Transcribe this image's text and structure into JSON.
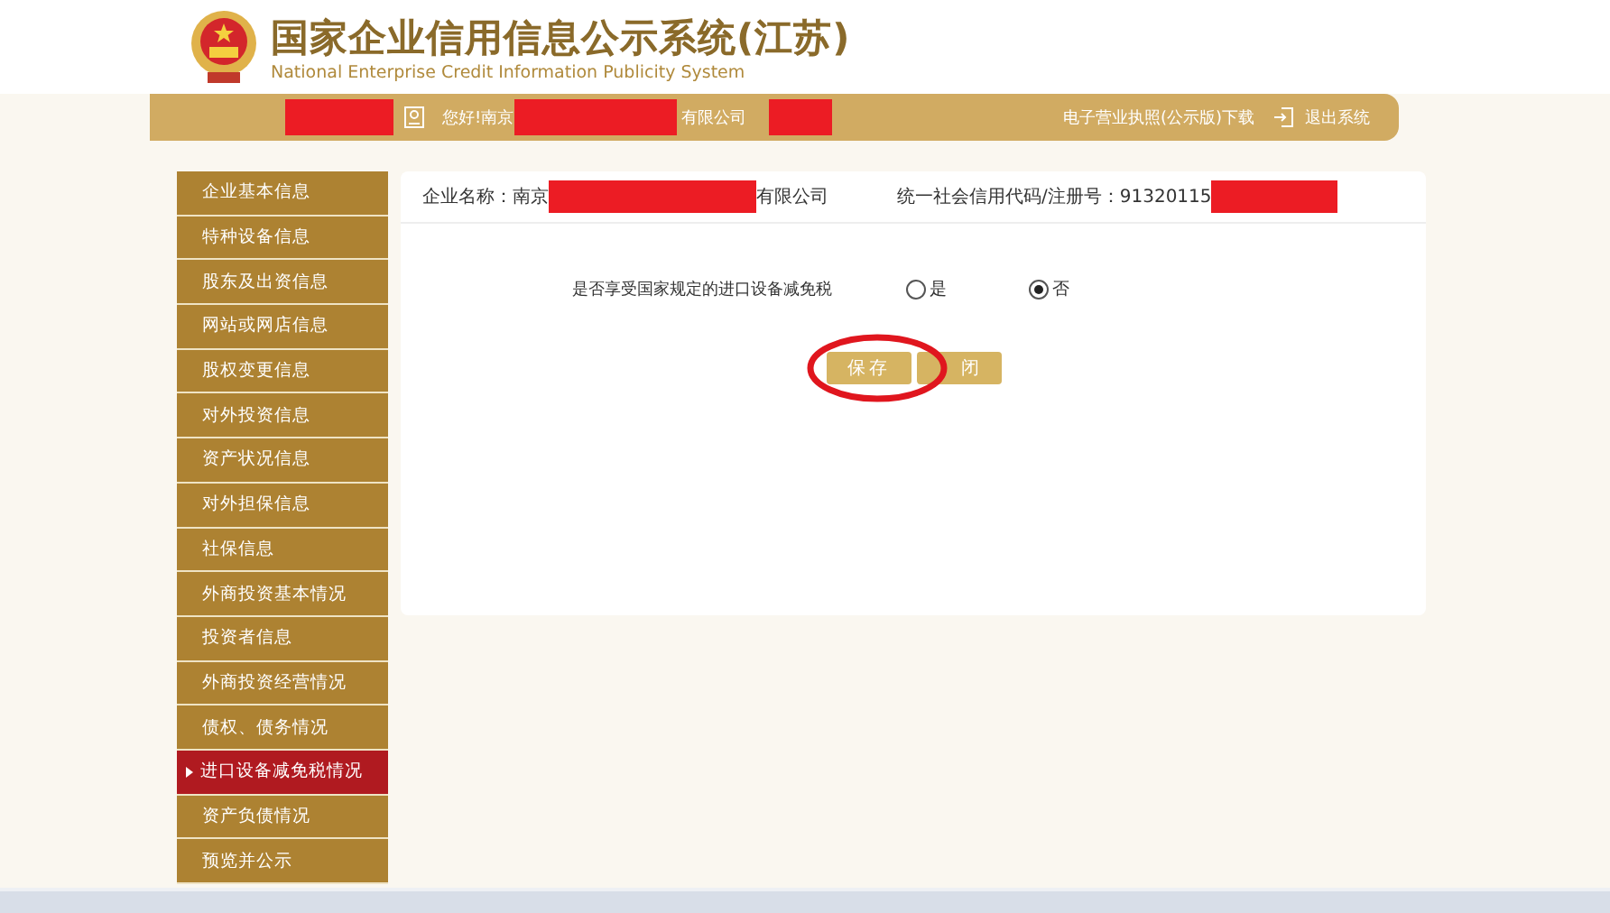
{
  "header": {
    "title": "国家企业信用信息公示系统(江苏)",
    "subtitle": "National Enterprise Credit Information Publicity System"
  },
  "topbar": {
    "greeting_start": "您好!南京",
    "greeting_end": "有限公司",
    "links": [
      {
        "label": "电子营业执照(公示版)下载",
        "kind": "text"
      },
      {
        "label": "退出系统",
        "kind": "logout"
      }
    ]
  },
  "sidebar": {
    "items": [
      {
        "label": "企业基本信息",
        "selected": false
      },
      {
        "label": "特种设备信息",
        "selected": false
      },
      {
        "label": "股东及出资信息",
        "selected": false
      },
      {
        "label": "网站或网店信息",
        "selected": false
      },
      {
        "label": "股权变更信息",
        "selected": false
      },
      {
        "label": "对外投资信息",
        "selected": false
      },
      {
        "label": "资产状况信息",
        "selected": false
      },
      {
        "label": "对外担保信息",
        "selected": false
      },
      {
        "label": "社保信息",
        "selected": false
      },
      {
        "label": "外商投资基本情况",
        "selected": false
      },
      {
        "label": "投资者信息",
        "selected": false
      },
      {
        "label": "外商投资经营情况",
        "selected": false
      },
      {
        "label": "债权、债务情况",
        "selected": false
      },
      {
        "label": "进口设备减免税情况",
        "selected": true
      },
      {
        "label": "资产负债情况",
        "selected": false
      },
      {
        "label": "预览并公示",
        "selected": false
      }
    ]
  },
  "company": {
    "name_label": "企业名称：南京",
    "name_end": "有限公司",
    "code_label": "统一社会信用代码/注册号：91320115"
  },
  "question": {
    "label": "是否享受国家规定的进口设备减免税",
    "options": [
      {
        "label": "是",
        "selected": false
      },
      {
        "label": "否",
        "selected": true
      }
    ]
  },
  "buttons": [
    "保存",
    "闭"
  ]
}
